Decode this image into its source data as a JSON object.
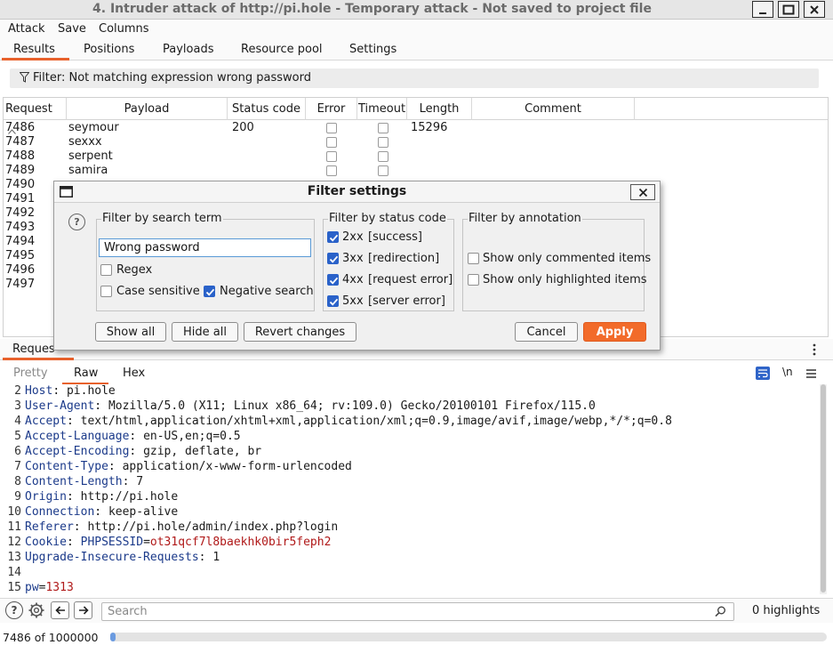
{
  "window": {
    "title": "4. Intruder attack of http://pi.hole - Temporary attack - Not saved to project file"
  },
  "menu": [
    "Attack",
    "Save",
    "Columns"
  ],
  "tabs": [
    "Results",
    "Positions",
    "Payloads",
    "Resource pool",
    "Settings"
  ],
  "filter_bar": {
    "text": "Filter: Not matching expression wrong password"
  },
  "results_table": {
    "columns": [
      "Request",
      "Payload",
      "Status code",
      "Error",
      "Timeout",
      "Length",
      "Comment"
    ],
    "rows": [
      {
        "request": "7486",
        "payload": "seymour",
        "status": "200",
        "length": "15296"
      },
      {
        "request": "7487",
        "payload": "sexxx",
        "status": "",
        "length": ""
      },
      {
        "request": "7488",
        "payload": "serpent",
        "status": "",
        "length": ""
      },
      {
        "request": "7489",
        "payload": "samira",
        "status": "",
        "length": ""
      },
      {
        "request": "7490",
        "payload": "",
        "status": "",
        "length": ""
      },
      {
        "request": "7491",
        "payload": "",
        "status": "",
        "length": ""
      },
      {
        "request": "7492",
        "payload": "",
        "status": "",
        "length": ""
      },
      {
        "request": "7493",
        "payload": "",
        "status": "",
        "length": ""
      },
      {
        "request": "7494",
        "payload": "",
        "status": "",
        "length": ""
      },
      {
        "request": "7495",
        "payload": "",
        "status": "",
        "length": ""
      },
      {
        "request": "7496",
        "payload": "",
        "status": "",
        "length": ""
      },
      {
        "request": "7497",
        "payload": "",
        "status": "",
        "length": ""
      }
    ]
  },
  "lower_panel": {
    "tab_label": "Reques",
    "subtabs": [
      "Pretty",
      "Raw",
      "Hex"
    ],
    "newline_toggle": "\\n",
    "lines": [
      {
        "n": "2",
        "key": "Host",
        "sep": ": ",
        "val": "pi.hole"
      },
      {
        "n": "3",
        "key": "User-Agent",
        "sep": ": ",
        "val": "Mozilla/5.0 (X11; Linux x86_64; rv:109.0) Gecko/20100101 Firefox/115.0"
      },
      {
        "n": "4",
        "key": "Accept",
        "sep": ": ",
        "val": "text/html,application/xhtml+xml,application/xml;q=0.9,image/avif,image/webp,*/*;q=0.8"
      },
      {
        "n": "5",
        "key": "Accept-Language",
        "sep": ": ",
        "val": "en-US,en;q=0.5"
      },
      {
        "n": "6",
        "key": "Accept-Encoding",
        "sep": ": ",
        "val": "gzip, deflate, br"
      },
      {
        "n": "7",
        "key": "Content-Type",
        "sep": ": ",
        "val": "application/x-www-form-urlencoded"
      },
      {
        "n": "8",
        "key": "Content-Length",
        "sep": ": ",
        "val": "7"
      },
      {
        "n": "9",
        "key": "Origin",
        "sep": ": ",
        "val": "http://pi.hole"
      },
      {
        "n": "10",
        "key": "Connection",
        "sep": ": ",
        "val": "keep-alive"
      },
      {
        "n": "11",
        "key": "Referer",
        "sep": ": ",
        "val": "http://pi.hole/admin/index.php?login"
      },
      {
        "n": "12",
        "key": "Cookie",
        "sep": ": ",
        "val": ""
      },
      {
        "n": "13",
        "key": "Upgrade-Insecure-Requests",
        "sep": ": ",
        "val": "1"
      },
      {
        "n": "14",
        "key": "",
        "sep": "",
        "val": ""
      },
      {
        "n": "15",
        "key": "",
        "sep": "",
        "val": ""
      }
    ],
    "cookie": {
      "name": "PHPSESSID",
      "eq": "=",
      "value": "ot31qcf7l8baekhk0bir5feph2"
    },
    "body": {
      "name": "pw",
      "eq": "=",
      "value": "1313"
    }
  },
  "search": {
    "placeholder": "Search",
    "highlights": "0 highlights"
  },
  "status": {
    "progress_text": "7486 of 1000000",
    "progress_fraction": 0.0075
  },
  "dialog": {
    "title": "Filter settings",
    "search_group": {
      "legend": "Filter by search term",
      "term": "Wrong password",
      "regex": {
        "label": "Regex",
        "checked": false
      },
      "case_sensitive": {
        "label": "Case sensitive",
        "checked": false
      },
      "negative": {
        "label": "Negative search",
        "checked": true
      }
    },
    "status_group": {
      "legend": "Filter by status code",
      "items": [
        {
          "code": "2xx",
          "desc": "[success]",
          "checked": true
        },
        {
          "code": "3xx",
          "desc": "[redirection]",
          "checked": true
        },
        {
          "code": "4xx",
          "desc": "[request error]",
          "checked": true
        },
        {
          "code": "5xx",
          "desc": "[server error]",
          "checked": true
        }
      ]
    },
    "annotation_group": {
      "legend": "Filter by annotation",
      "commented": {
        "label": "Show only commented items",
        "checked": false
      },
      "highlighted": {
        "label": "Show only highlighted items",
        "checked": false
      }
    },
    "buttons": {
      "show_all": "Show all",
      "hide_all": "Hide all",
      "revert": "Revert changes",
      "cancel": "Cancel",
      "apply": "Apply"
    }
  },
  "colors": {
    "accent": "#f26b2a",
    "checkbox": "#2a62c9",
    "header_key": "#1b3a8a",
    "value_red": "#b01919"
  }
}
